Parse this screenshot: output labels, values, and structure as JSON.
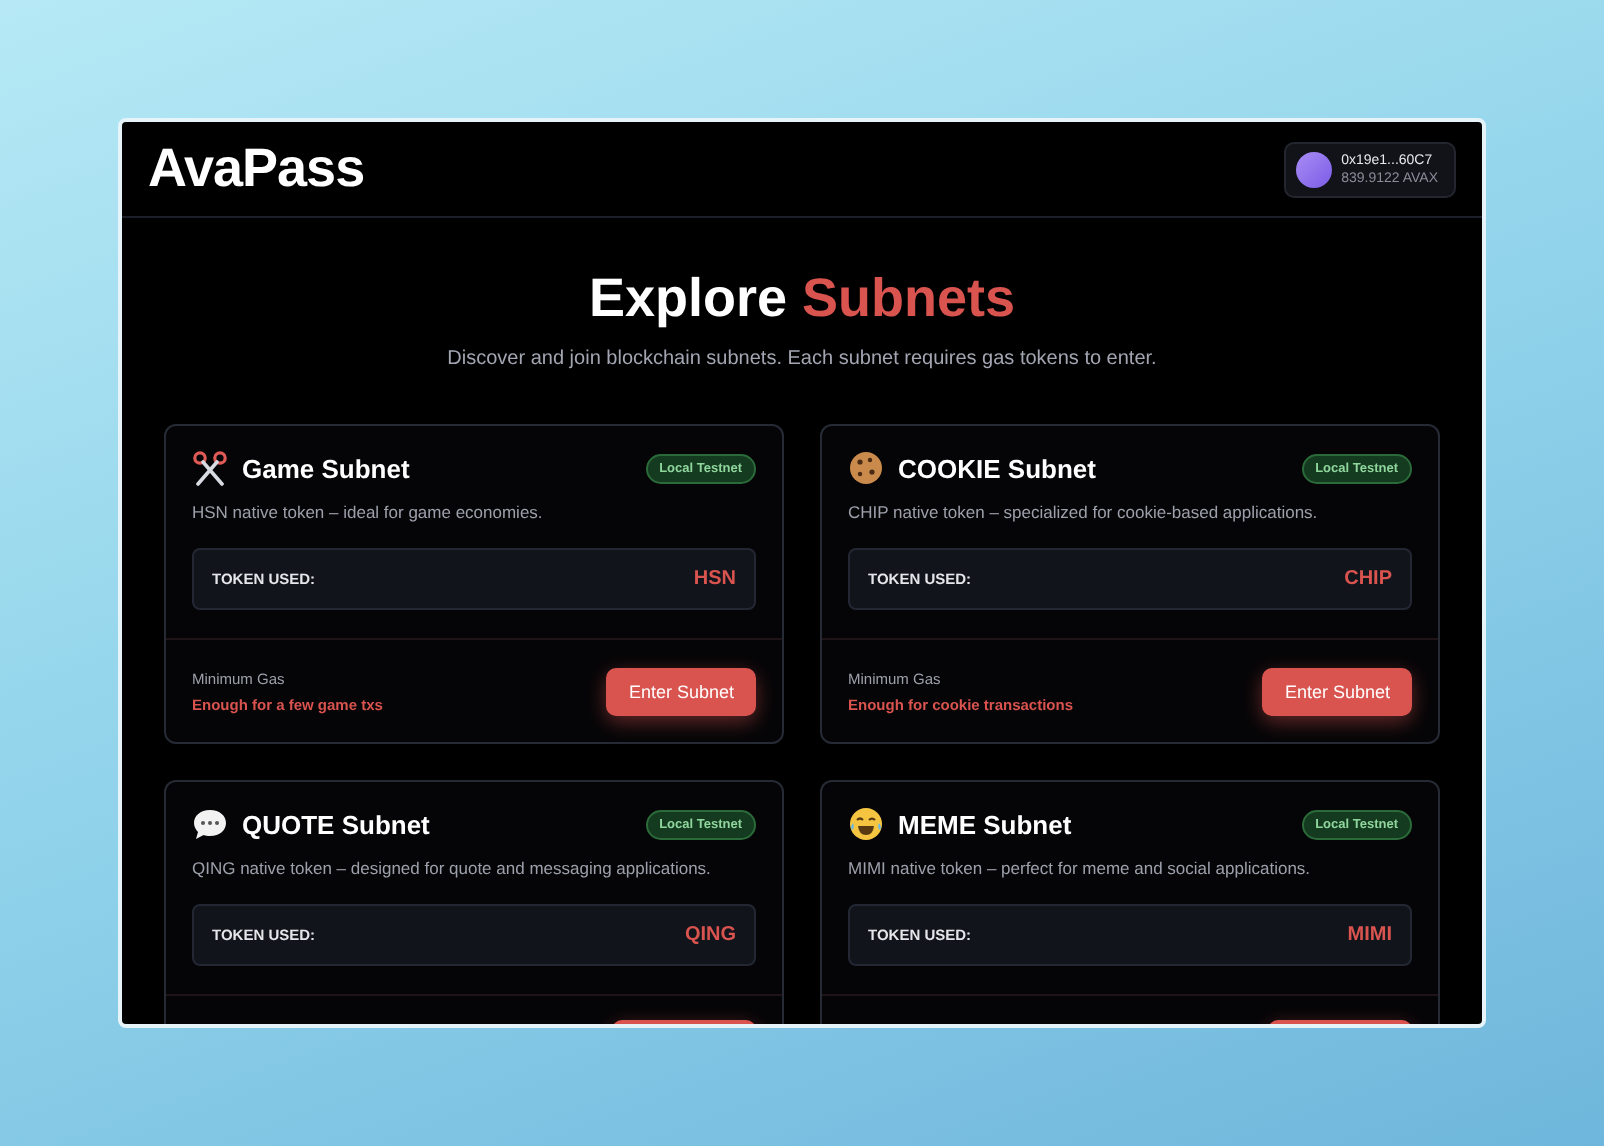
{
  "header": {
    "logo": "AvaPass",
    "wallet": {
      "address": "0x19e1...60C7",
      "balance": "839.9122 AVAX"
    }
  },
  "hero": {
    "title": "Explore **Subnets**",
    "subtitle": "Discover and join blockchain subnets. Each subnet requires gas tokens to enter."
  },
  "subnets": [
    {
      "name": "Game Subnet",
      "badge": "Local Testnet",
      "description": "HSN native token – ideal for game economies.",
      "token_label": "TOKEN USED:",
      "token": "HSN",
      "gas_label": "Minimum Gas",
      "gas_note": "Enough for a few game txs",
      "button": "Enter Subnet"
    },
    {
      "name": "COOKIE Subnet",
      "badge": "Local Testnet",
      "description": "CHIP native token – specialized for cookie-based applications.",
      "token_label": "TOKEN USED:",
      "token": "CHIP",
      "gas_label": "Minimum Gas",
      "gas_note": "Enough for cookie transactions",
      "button": "Enter Subnet"
    },
    {
      "name": "QUOTE Subnet",
      "badge": "Local Testnet",
      "description": "QING native token – designed for quote and messaging applications.",
      "token_label": "TOKEN USED:",
      "token": "QING"
    },
    {
      "name": "MEME Subnet",
      "badge": "Local Testnet",
      "description": "MIMI native token – perfect for meme and social applications.",
      "token_label": "TOKEN USED:",
      "token": "MIMI"
    }
  ]
}
